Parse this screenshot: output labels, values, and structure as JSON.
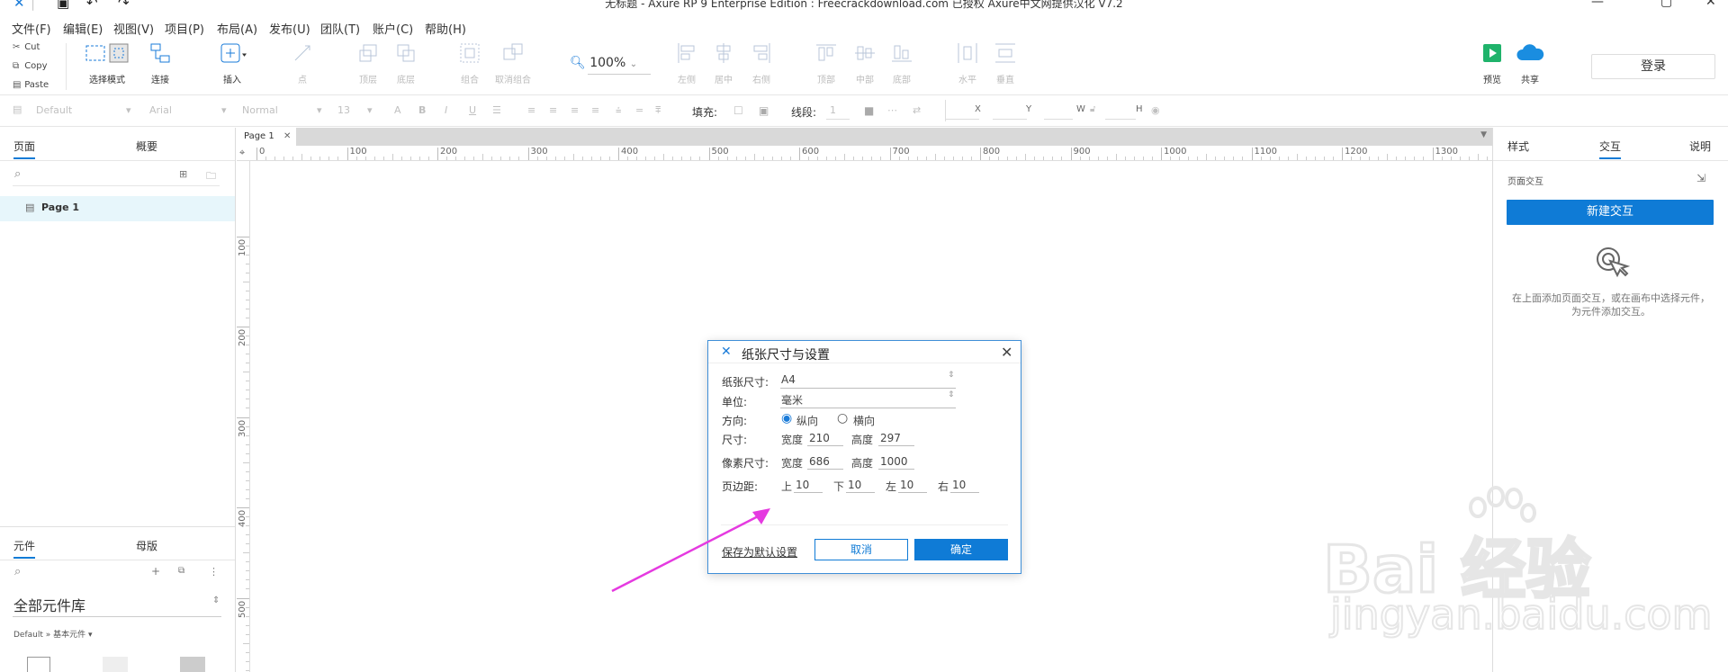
{
  "titlebar": {
    "title": "无标题 - Axure RP 9 Enterprise Edition : Freecrackdownload.com 已授权    Axure中文网提供汉化 V7.2"
  },
  "menu": [
    "文件(F)",
    "编辑(E)",
    "视图(V)",
    "项目(P)",
    "布局(A)",
    "发布(U)",
    "团队(T)",
    "账户(C)",
    "帮助(H)"
  ],
  "clipboard": {
    "cut": "Cut",
    "copy": "Copy",
    "paste": "Paste"
  },
  "toolbar": {
    "select_mode": "选择模式",
    "connect": "连接",
    "insert": "插入",
    "point": "点",
    "top_layer": "顶层",
    "bottom_layer": "底层",
    "group": "组合",
    "ungroup": "取消组合",
    "zoom": "100%",
    "align_left": "左侧",
    "align_center": "居中",
    "align_right": "右侧",
    "align_top": "顶部",
    "align_middle": "中部",
    "align_bottom": "底部",
    "dist_horizontal": "水平",
    "dist_vertical": "垂直",
    "preview": "预览",
    "share": "共享",
    "login": "登录"
  },
  "stylebar": {
    "style": "Default",
    "font": "Arial",
    "weight": "Normal",
    "size": "13",
    "fill_label": "填充:",
    "stroke_label": "线段:",
    "stroke_width": "1",
    "x_label": "X",
    "y_label": "Y",
    "w_label": "W",
    "h_label": "H"
  },
  "left_panel": {
    "tabs": [
      "页面",
      "概要"
    ],
    "pages": [
      "Page 1"
    ],
    "lib_tabs": [
      "元件",
      "母版"
    ],
    "library_name": "全部元件库",
    "library_sub": "Default » 基本元件 ▾"
  },
  "canvas": {
    "tab": "Page 1",
    "ruler_h": [
      "0",
      "100",
      "200",
      "300",
      "400",
      "500",
      "600",
      "700",
      "800",
      "900",
      "1000",
      "1100",
      "1200",
      "1300"
    ],
    "ruler_v": [
      "100",
      "200",
      "300",
      "400",
      "500"
    ]
  },
  "right_panel": {
    "tabs": [
      "样式",
      "交互",
      "说明"
    ],
    "section": "页面交互",
    "new_button": "新建交互",
    "hint": "在上面添加页面交互，或在画布中选择元件，为元件添加交互。"
  },
  "dialog": {
    "title": "纸张尺寸与设置",
    "paper_label": "纸张尺寸:",
    "paper_value": "A4",
    "unit_label": "单位:",
    "unit_value": "毫米",
    "orientation_label": "方向:",
    "portrait": "纵向",
    "landscape": "横向",
    "orientation_selected": "纵向",
    "size_label": "尺寸:",
    "width_label": "宽度",
    "width_value": "210",
    "height_label": "高度",
    "height_value": "297",
    "pixel_label": "像素尺寸:",
    "pixel_width_label": "宽度",
    "pixel_width": "686",
    "pixel_height_label": "高度",
    "pixel_height": "1000",
    "margin_label": "页边距:",
    "top_label": "上",
    "top_value": "10",
    "bottom_label": "下",
    "bottom_value": "10",
    "left_label": "左",
    "left_value": "10",
    "right_label": "右",
    "right_value": "10",
    "save_default": "保存为默认设置",
    "cancel": "取消",
    "ok": "确定"
  },
  "watermark": {
    "brand": "Bai 经验",
    "url": "jingyan.baidu.com"
  },
  "colors": {
    "accent": "#0f7bd6",
    "arrow": "#e53ae0"
  }
}
